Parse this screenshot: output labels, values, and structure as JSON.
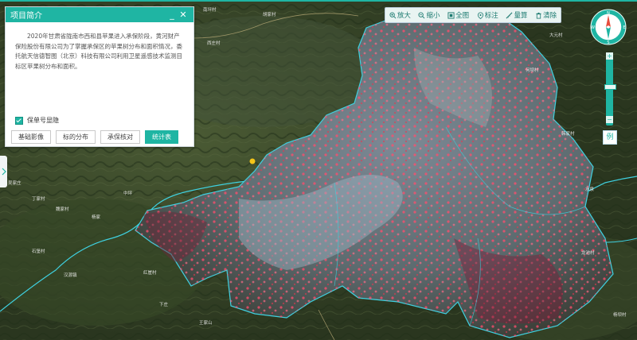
{
  "panel": {
    "title": "项目简介",
    "minimize": "_",
    "close": "✕",
    "description": "2020年甘肃省陇南市西和县苹果进入承保阶段，黄河财产保险股份有限公司为了掌握承保区的苹果树分布和面积情况，委托航天信德智图（北京）科技有限公司利用卫星遥感技术监测目标区苹果树分布和面积。",
    "checkbox_label": "保单号显隐",
    "buttons": [
      "基础影像",
      "标的分布",
      "承保核对",
      "统计表"
    ],
    "active_button": "统计表"
  },
  "toolbar": {
    "zoom_in": "放大",
    "zoom_out": "缩小",
    "full": "全图",
    "mark": "标注",
    "measure": "量算",
    "clear": "清除"
  },
  "map_controls": {
    "compass_n": "N",
    "compass_s": "S",
    "compass_e": "E",
    "compass_w": "W",
    "zoom_plus": "+",
    "zoom_minus": "−",
    "legend": "例"
  },
  "colors": {
    "accent": "#1fb5a3",
    "apple_area": "#ff4d6d",
    "boundary": "#3fd1e0"
  },
  "place_names": [
    "南坪村",
    "胡家村",
    "吕山村",
    "大元村",
    "西庄村",
    "吴家庄",
    "丁家村",
    "魏家村",
    "杨家",
    "中坪",
    "石堡村",
    "汉源镇",
    "红崖村",
    "下庄",
    "王家山",
    "何坝村",
    "韩家村",
    "水泉",
    "龙池村",
    "杨坝村"
  ]
}
